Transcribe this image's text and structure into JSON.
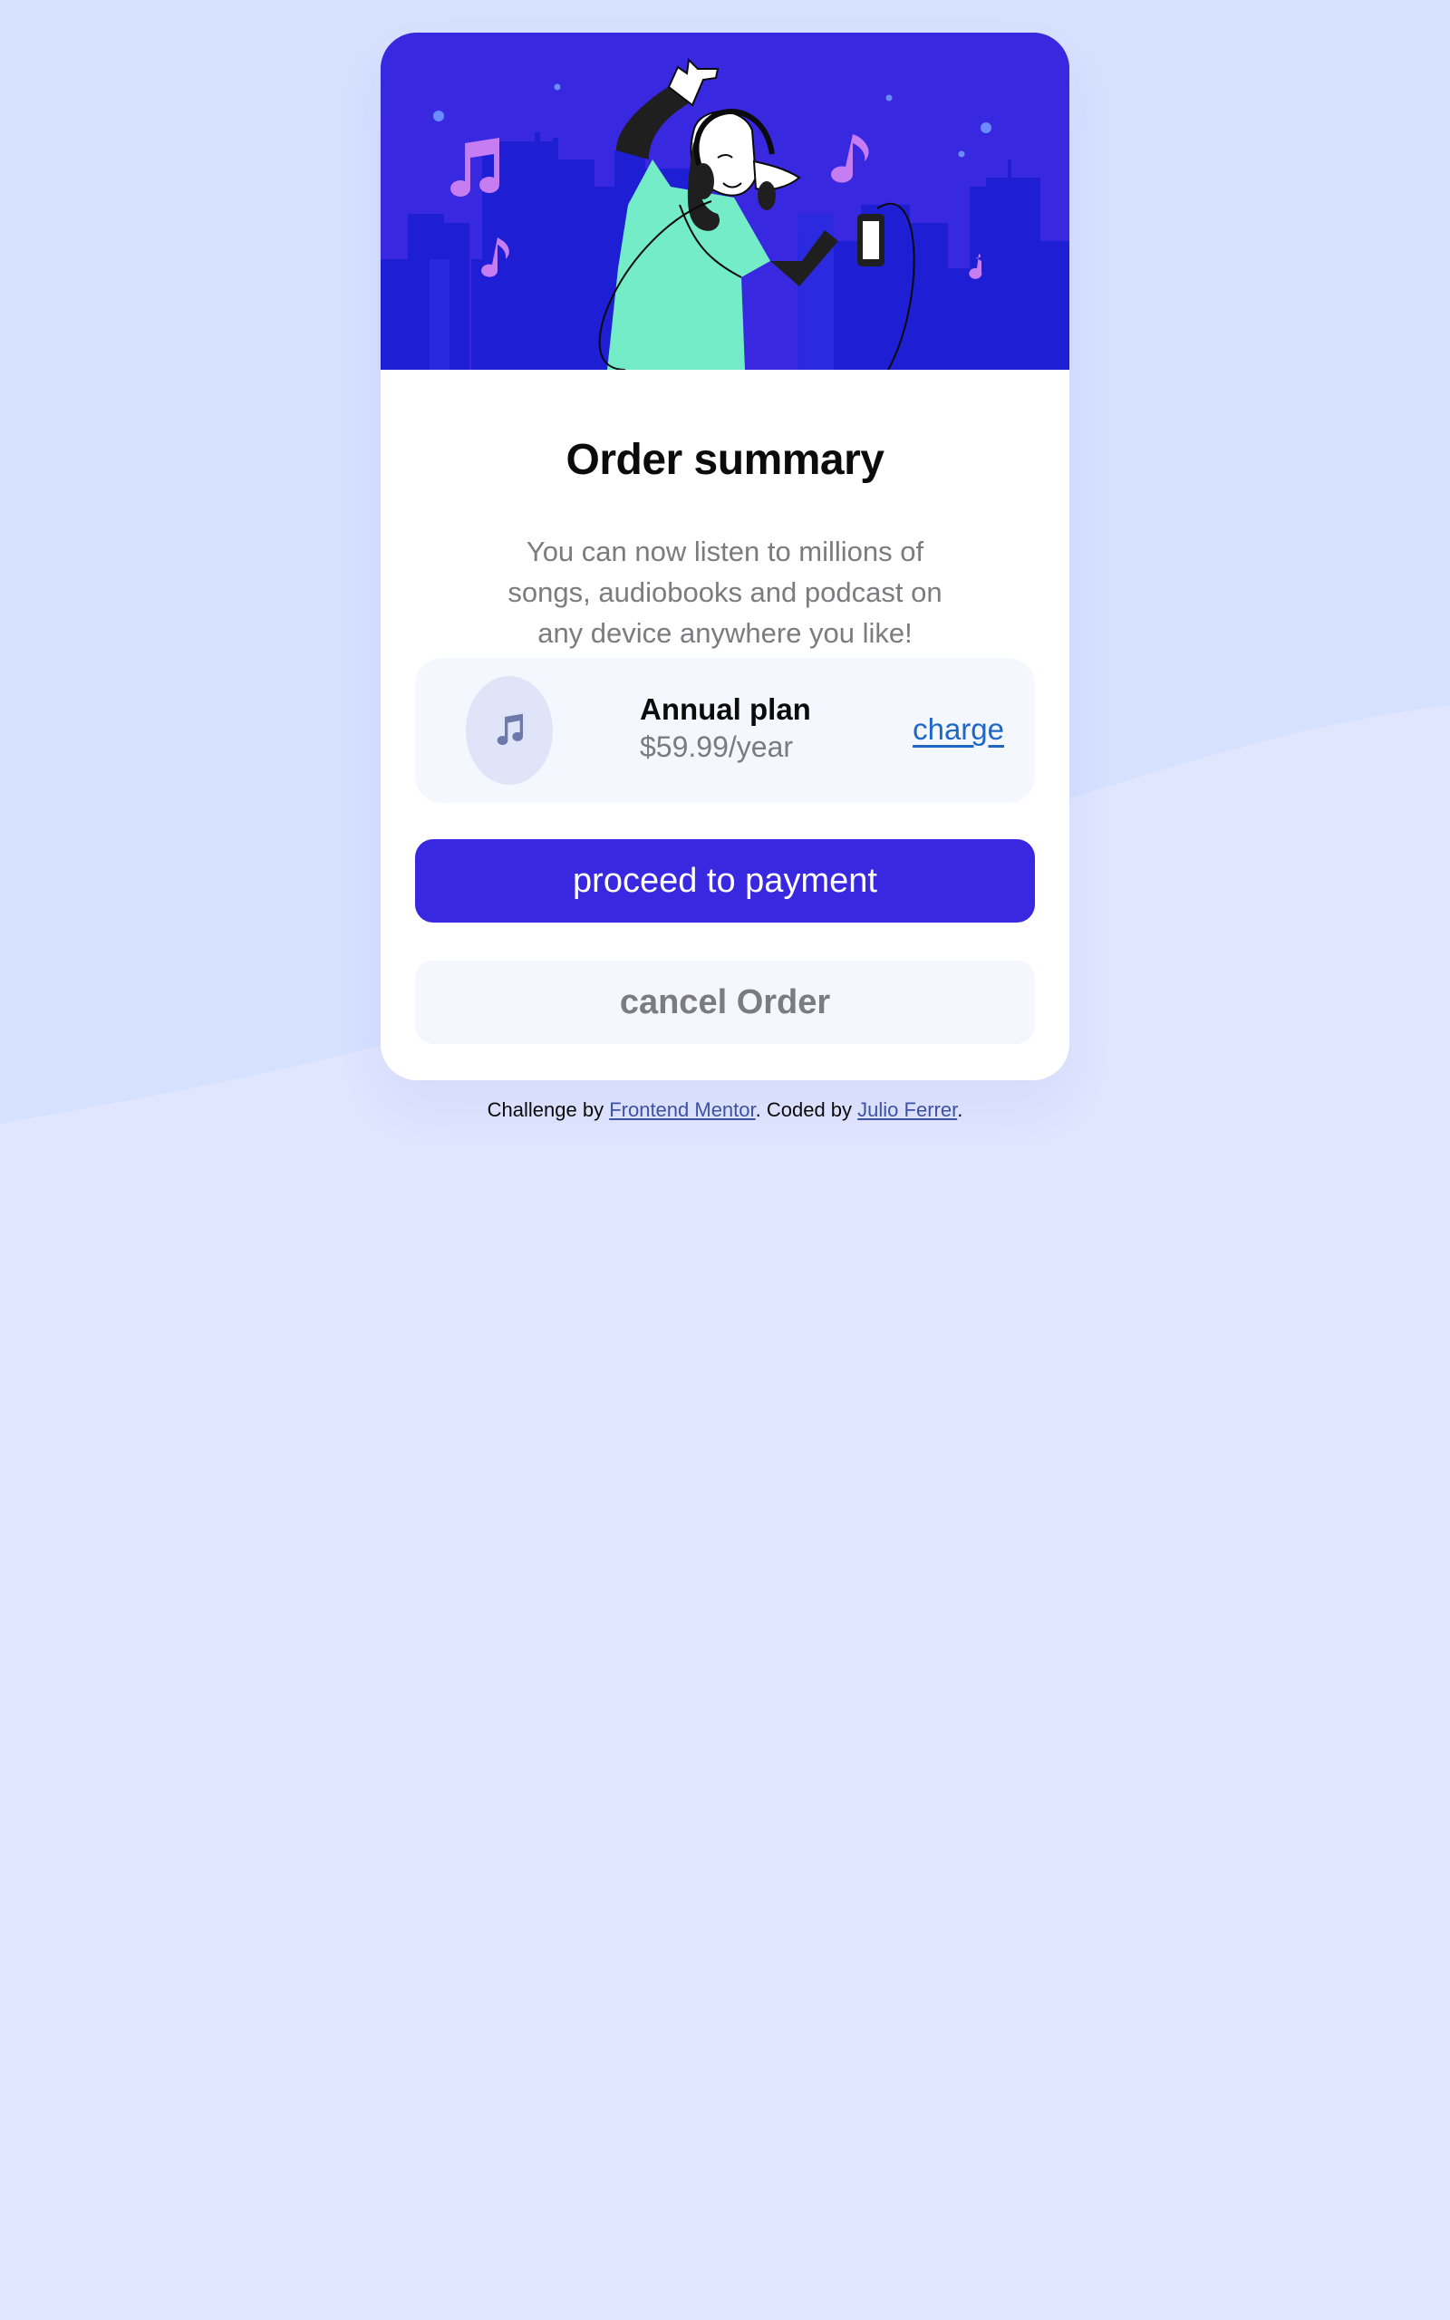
{
  "colors": {
    "page_background": "#e0e6fe",
    "wave": "#d6e1ff",
    "primary": "#3829e0",
    "link": "#1f67c6",
    "muted_text": "#7b7b80",
    "panel": "#f4f7fe"
  },
  "hero": {
    "illustration": "music-listener-illustration"
  },
  "summary": {
    "title": "Order summary",
    "description": "You can now listen to millions of songs, audiobooks and podcast on any device anywhere you like!"
  },
  "plan": {
    "icon": "music-note-icon",
    "name": "Annual plan",
    "price": "$59.99/year",
    "change_label": "charge"
  },
  "actions": {
    "proceed_label": "proceed to payment",
    "cancel_label": "cancel Order"
  },
  "attribution": {
    "prefix": "Challenge by ",
    "challenge_link": "Frontend Mentor",
    "middle": ". Coded by ",
    "author_link": "Julio Ferrer",
    "suffix": "."
  }
}
